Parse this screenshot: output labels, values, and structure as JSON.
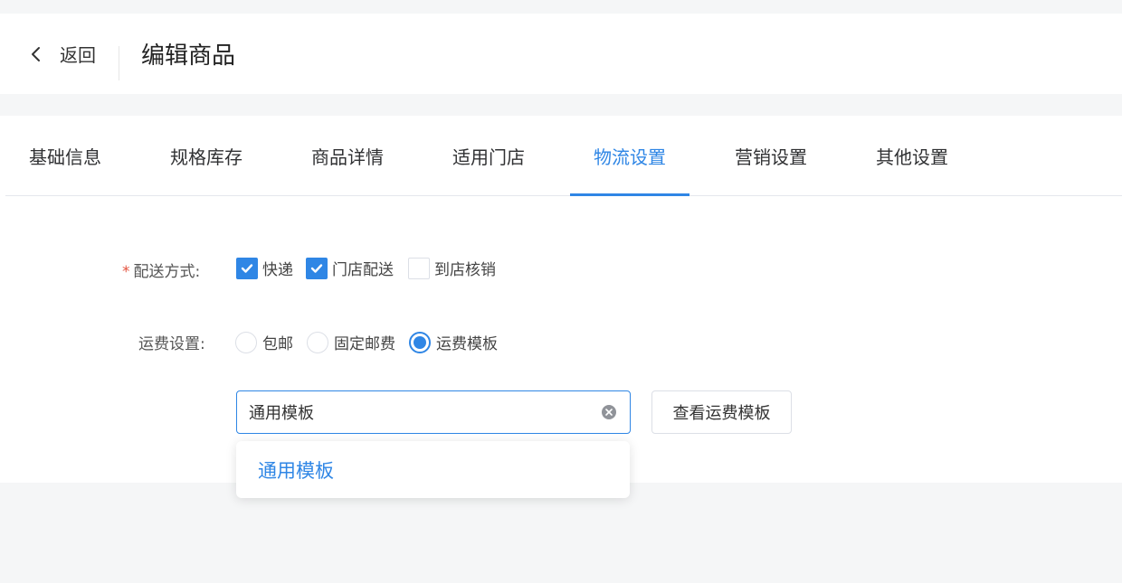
{
  "header": {
    "back_label": "返回",
    "title": "编辑商品"
  },
  "tabs": [
    {
      "label": "基础信息",
      "active": false
    },
    {
      "label": "规格库存",
      "active": false
    },
    {
      "label": "商品详情",
      "active": false
    },
    {
      "label": "适用门店",
      "active": false
    },
    {
      "label": "物流设置",
      "active": true
    },
    {
      "label": "营销设置",
      "active": false
    },
    {
      "label": "其他设置",
      "active": false
    }
  ],
  "delivery": {
    "required_mark": "*",
    "label": "配送方式:",
    "options": [
      {
        "label": "快递",
        "checked": true
      },
      {
        "label": "门店配送",
        "checked": true
      },
      {
        "label": "到店核销",
        "checked": false
      }
    ]
  },
  "shipping": {
    "label": "运费设置:",
    "options": [
      {
        "label": "包邮",
        "selected": false
      },
      {
        "label": "固定邮费",
        "selected": false
      },
      {
        "label": "运费模板",
        "selected": true
      }
    ],
    "template_select_value": "通用模板",
    "view_template_button": "查看运费模板",
    "dropdown_options": [
      "通用模板"
    ]
  },
  "colors": {
    "accent": "#2f86e5",
    "required": "#e4533f"
  }
}
